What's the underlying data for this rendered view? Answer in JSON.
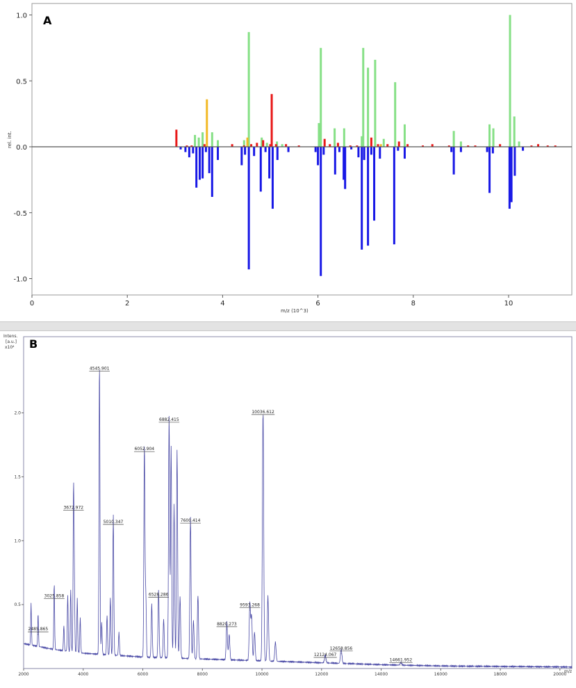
{
  "chart_data": [
    {
      "type": "bar",
      "panel_label": "A",
      "xlabel": "m/z (10^3)",
      "ylabel": "rel. int.",
      "xlim": [
        0,
        11.3
      ],
      "ylim": [
        -1.08,
        1.08
      ],
      "x_ticks": [
        "0",
        "2",
        "4",
        "6",
        "8",
        "10"
      ],
      "y_ticks": [
        "1.0",
        "0.5",
        "0.0",
        "-0.5",
        "-1.0"
      ],
      "zero_line": true,
      "colors": {
        "green": "#86e086",
        "red": "#e81818",
        "yellow": "#f2b925",
        "blue": "#1818e6",
        "axis": "#444444"
      },
      "series": [
        {
          "color": "green",
          "points": [
            [
              3.42,
              0.09
            ],
            [
              3.5,
              0.07
            ],
            [
              3.58,
              0.11
            ],
            [
              3.78,
              0.11
            ],
            [
              3.9,
              0.05
            ],
            [
              4.45,
              0.05
            ],
            [
              4.55,
              0.87
            ],
            [
              4.82,
              0.07
            ],
            [
              4.93,
              0.03
            ],
            [
              5.14,
              0.04
            ],
            [
              5.25,
              0.02
            ],
            [
              6.02,
              0.18
            ],
            [
              6.06,
              0.75
            ],
            [
              6.35,
              0.14
            ],
            [
              6.55,
              0.14
            ],
            [
              6.92,
              0.08
            ],
            [
              6.95,
              0.75
            ],
            [
              7.05,
              0.6
            ],
            [
              7.2,
              0.66
            ],
            [
              7.38,
              0.06
            ],
            [
              7.62,
              0.49
            ],
            [
              7.82,
              0.17
            ],
            [
              8.85,
              0.12
            ],
            [
              9.0,
              0.04
            ],
            [
              9.6,
              0.17
            ],
            [
              9.68,
              0.14
            ],
            [
              10.03,
              1.0
            ],
            [
              10.12,
              0.23
            ],
            [
              10.22,
              0.04
            ]
          ]
        },
        {
          "color": "red",
          "points": [
            [
              3.03,
              0.13
            ],
            [
              3.25,
              0.01
            ],
            [
              3.35,
              0.01
            ],
            [
              3.62,
              0.02
            ],
            [
              4.2,
              0.02
            ],
            [
              4.45,
              0.01
            ],
            [
              4.6,
              0.02
            ],
            [
              4.72,
              0.03
            ],
            [
              4.85,
              0.05
            ],
            [
              5.0,
              0.02
            ],
            [
              5.03,
              0.4
            ],
            [
              5.12,
              0.02
            ],
            [
              5.33,
              0.02
            ],
            [
              5.6,
              0.01
            ],
            [
              6.14,
              0.06
            ],
            [
              6.25,
              0.02
            ],
            [
              6.42,
              0.03
            ],
            [
              6.68,
              0.01
            ],
            [
              6.82,
              0.01
            ],
            [
              7.12,
              0.07
            ],
            [
              7.26,
              0.02
            ],
            [
              7.46,
              0.02
            ],
            [
              7.7,
              0.04
            ],
            [
              7.88,
              0.02
            ],
            [
              8.2,
              0.01
            ],
            [
              8.4,
              0.02
            ],
            [
              8.75,
              0.01
            ],
            [
              9.15,
              0.01
            ],
            [
              9.3,
              0.01
            ],
            [
              9.82,
              0.02
            ],
            [
              10.48,
              0.01
            ],
            [
              10.62,
              0.02
            ],
            [
              10.82,
              0.01
            ],
            [
              10.98,
              0.01
            ]
          ]
        },
        {
          "color": "yellow",
          "points": [
            [
              3.67,
              0.36
            ],
            [
              4.52,
              0.07
            ],
            [
              7.32,
              0.02
            ]
          ]
        },
        {
          "color": "blue",
          "points": [
            [
              3.12,
              -0.02
            ],
            [
              3.22,
              -0.04
            ],
            [
              3.3,
              -0.08
            ],
            [
              3.38,
              -0.05
            ],
            [
              3.45,
              -0.31
            ],
            [
              3.52,
              -0.25
            ],
            [
              3.58,
              -0.24
            ],
            [
              3.65,
              -0.04
            ],
            [
              3.72,
              -0.2
            ],
            [
              3.78,
              -0.38
            ],
            [
              3.9,
              -0.1
            ],
            [
              4.4,
              -0.14
            ],
            [
              4.47,
              -0.06
            ],
            [
              4.55,
              -0.93
            ],
            [
              4.66,
              -0.07
            ],
            [
              4.8,
              -0.34
            ],
            [
              4.9,
              -0.04
            ],
            [
              4.98,
              -0.24
            ],
            [
              5.05,
              -0.47
            ],
            [
              5.15,
              -0.1
            ],
            [
              5.38,
              -0.04
            ],
            [
              5.95,
              -0.04
            ],
            [
              6.0,
              -0.14
            ],
            [
              6.06,
              -0.98
            ],
            [
              6.12,
              -0.06
            ],
            [
              6.36,
              -0.21
            ],
            [
              6.45,
              -0.04
            ],
            [
              6.54,
              -0.25
            ],
            [
              6.57,
              -0.32
            ],
            [
              6.7,
              -0.02
            ],
            [
              6.85,
              -0.08
            ],
            [
              6.92,
              -0.78
            ],
            [
              6.97,
              -0.1
            ],
            [
              7.05,
              -0.75
            ],
            [
              7.12,
              -0.06
            ],
            [
              7.18,
              -0.56
            ],
            [
              7.3,
              -0.09
            ],
            [
              7.6,
              -0.74
            ],
            [
              7.68,
              -0.03
            ],
            [
              7.82,
              -0.09
            ],
            [
              8.8,
              -0.04
            ],
            [
              8.85,
              -0.21
            ],
            [
              9.0,
              -0.04
            ],
            [
              9.55,
              -0.04
            ],
            [
              9.6,
              -0.35
            ],
            [
              9.67,
              -0.05
            ],
            [
              10.02,
              -0.47
            ],
            [
              10.06,
              -0.42
            ],
            [
              10.13,
              -0.22
            ],
            [
              10.3,
              -0.03
            ]
          ]
        }
      ]
    },
    {
      "type": "line",
      "panel_label": "B",
      "ylabel_lines": [
        "Intens.",
        "[a.u.]",
        "x10⁴"
      ],
      "xunit": "m/z",
      "xlim": [
        2000,
        20400
      ],
      "ylim": [
        0,
        2.52
      ],
      "x_ticks": [
        "2000",
        "4000",
        "6000",
        "8000",
        "10000",
        "12000",
        "14000",
        "16000",
        "18000",
        "20000"
      ],
      "x_tick_values": [
        2000,
        4000,
        6000,
        8000,
        10000,
        12000,
        14000,
        16000,
        18000,
        20000
      ],
      "y_ticks": [
        "0.5",
        "1.0",
        "1.5",
        "2.0"
      ],
      "y_tick_values": [
        0.5,
        1.0,
        1.5,
        2.0
      ],
      "line_color": "#4a4aa6",
      "baseline": [
        [
          2000,
          0.195
        ],
        [
          3000,
          0.15
        ],
        [
          4000,
          0.12
        ],
        [
          5000,
          0.105
        ],
        [
          6000,
          0.09
        ],
        [
          8000,
          0.075
        ],
        [
          10000,
          0.06
        ],
        [
          12000,
          0.045
        ],
        [
          14000,
          0.03
        ],
        [
          16000,
          0.02
        ],
        [
          20400,
          0.012
        ]
      ],
      "peaks": [
        {
          "x": 2250,
          "y": 0.33
        },
        {
          "x": 2486,
          "y": 0.26
        },
        {
          "x": 3026,
          "y": 0.52
        },
        {
          "x": 3350,
          "y": 0.2
        },
        {
          "x": 3480,
          "y": 0.44
        },
        {
          "x": 3580,
          "y": 0.49
        },
        {
          "x": 3674,
          "y": 1.21
        },
        {
          "x": 3700,
          "y": 0.57
        },
        {
          "x": 3800,
          "y": 0.42
        },
        {
          "x": 3900,
          "y": 0.27
        },
        {
          "x": 4546,
          "y": 2.3
        },
        {
          "x": 4620,
          "y": 0.25
        },
        {
          "x": 4800,
          "y": 0.31
        },
        {
          "x": 4910,
          "y": 0.45
        },
        {
          "x": 5010,
          "y": 1.1
        },
        {
          "x": 5200,
          "y": 0.18
        },
        {
          "x": 6053,
          "y": 1.67
        },
        {
          "x": 6100,
          "y": 0.5
        },
        {
          "x": 6300,
          "y": 0.42
        },
        {
          "x": 6529,
          "y": 0.53
        },
        {
          "x": 6700,
          "y": 0.3
        },
        {
          "x": 6882,
          "y": 1.9
        },
        {
          "x": 6950,
          "y": 1.65
        },
        {
          "x": 7050,
          "y": 1.2
        },
        {
          "x": 7150,
          "y": 1.63
        },
        {
          "x": 7250,
          "y": 0.48
        },
        {
          "x": 7600,
          "y": 1.11
        },
        {
          "x": 7700,
          "y": 0.3
        },
        {
          "x": 7850,
          "y": 0.5
        },
        {
          "x": 8820,
          "y": 0.3
        },
        {
          "x": 8900,
          "y": 0.2
        },
        {
          "x": 9593,
          "y": 0.45
        },
        {
          "x": 9650,
          "y": 0.35
        },
        {
          "x": 9750,
          "y": 0.22
        },
        {
          "x": 10036,
          "y": 1.96
        },
        {
          "x": 10200,
          "y": 0.51
        },
        {
          "x": 10450,
          "y": 0.15
        },
        {
          "x": 12124,
          "y": 0.06
        },
        {
          "x": 12658,
          "y": 0.11
        },
        {
          "x": 14662,
          "y": 0.02
        }
      ],
      "peak_labels": [
        {
          "x": 2486,
          "y": 0.26,
          "text": "2485.865"
        },
        {
          "x": 3026,
          "y": 0.52,
          "text": "3025.858"
        },
        {
          "x": 3674,
          "y": 1.21,
          "text": "3672.972"
        },
        {
          "x": 4546,
          "y": 2.3,
          "text": "4545.901"
        },
        {
          "x": 5010,
          "y": 1.1,
          "text": "5010.347"
        },
        {
          "x": 6053,
          "y": 1.67,
          "text": "6052.904"
        },
        {
          "x": 6529,
          "y": 0.53,
          "text": "6528.286"
        },
        {
          "x": 6882,
          "y": 1.9,
          "text": "6882.415"
        },
        {
          "x": 7600,
          "y": 1.11,
          "text": "7600.414"
        },
        {
          "x": 8820,
          "y": 0.3,
          "text": "8820.273"
        },
        {
          "x": 9593,
          "y": 0.45,
          "text": "9593.268"
        },
        {
          "x": 10036,
          "y": 1.96,
          "text": "10036.612"
        },
        {
          "x": 12124,
          "y": 0.06,
          "text": "12124.067"
        },
        {
          "x": 12658,
          "y": 0.11,
          "text": "12658.856"
        },
        {
          "x": 14662,
          "y": 0.02,
          "text": "14661.952"
        }
      ]
    }
  ]
}
